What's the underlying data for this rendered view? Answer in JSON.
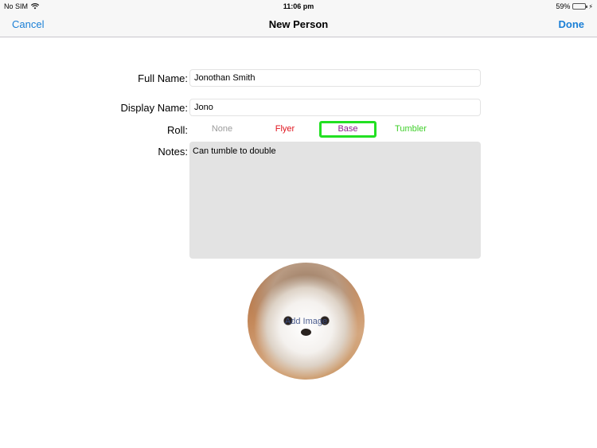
{
  "status_bar": {
    "carrier": "No SIM",
    "time": "11:06 pm",
    "battery_percent_label": "59%",
    "battery_level": 0.59
  },
  "nav": {
    "cancel_label": "Cancel",
    "title": "New Person",
    "done_label": "Done"
  },
  "form": {
    "full_name_label": "Full Name:",
    "full_name_value": "Jonothan Smith",
    "display_name_label": "Display Name:",
    "display_name_value": "Jono",
    "roll_label": "Roll:",
    "roll_options": [
      {
        "label": "None",
        "color": "#9b9b9b"
      },
      {
        "label": "Flyer",
        "color": "#e0141e"
      },
      {
        "label": "Base",
        "color": "#8b1a8b"
      },
      {
        "label": "Tumbler",
        "color": "#3fcf2a"
      }
    ],
    "roll_selected": "Base",
    "selection_color": "#22e022",
    "notes_label": "Notes:",
    "notes_value": "Can tumble to double"
  },
  "photo": {
    "button_label": "Add Image"
  },
  "colors": {
    "accent": "#1a7fd6",
    "notes_background": "#e3e3e3"
  }
}
